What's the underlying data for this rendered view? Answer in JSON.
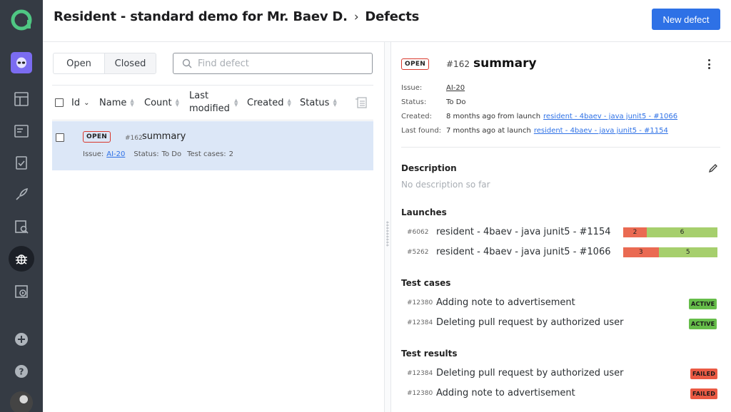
{
  "breadcrumb": {
    "project": "Resident - standard demo for Mr. Baev D.",
    "page": "Defects"
  },
  "header": {
    "new_button": "New defect"
  },
  "list": {
    "tabs": [
      "Open",
      "Closed"
    ],
    "search_placeholder": "Find defect",
    "columns": [
      "Id",
      "Name",
      "Count",
      "Last modified",
      "Created",
      "Status"
    ],
    "rows": [
      {
        "status_badge": "OPEN",
        "id": "#162",
        "name": "summary",
        "issue_label": "Issue:",
        "issue": "AI-20",
        "status_label": "Status:",
        "status": "To Do",
        "test_cases_label": "Test cases:",
        "test_cases": "2"
      }
    ]
  },
  "detail": {
    "status_badge": "OPEN",
    "id": "#162",
    "title": "summary",
    "info": {
      "issue_label": "Issue:",
      "issue": "AI-20",
      "status_label": "Status:",
      "status": "To Do",
      "created_label": "Created:",
      "created_text": "8 months ago from launch",
      "created_link": "resident - 4baev - java junit5 - #1066",
      "last_found_label": "Last found:",
      "last_found_text": "7 months ago at launch",
      "last_found_link": "resident - 4baev - java junit5 - #1154"
    },
    "description": {
      "title": "Description",
      "text": "No description so far"
    },
    "launches": {
      "title": "Launches",
      "items": [
        {
          "id": "#6062",
          "name": "resident - 4baev - java junit5 - #1154",
          "failed": 2,
          "passed": 6
        },
        {
          "id": "#5262",
          "name": "resident - 4baev - java junit5 - #1066",
          "failed": 3,
          "passed": 5
        }
      ]
    },
    "test_cases": {
      "title": "Test cases",
      "items": [
        {
          "id": "#12380",
          "name": "Adding note to advertisement",
          "status": "ACTIVE"
        },
        {
          "id": "#12384",
          "name": "Deleting pull request by authorized user",
          "status": "ACTIVE"
        }
      ]
    },
    "test_results": {
      "title": "Test results",
      "items": [
        {
          "id": "#12384",
          "name": "Deleting pull request by authorized user",
          "status": "FAILED"
        },
        {
          "id": "#12380",
          "name": "Adding note to advertisement",
          "status": "FAILED"
        }
      ]
    }
  },
  "colors": {
    "primary": "#2e71e6",
    "sidebar": "#353b44",
    "selected_row": "#dce7f7",
    "failed": "#ea6a52",
    "passed": "#a6cf6d",
    "active": "#66bd4a",
    "open_border": "#d9372b"
  }
}
